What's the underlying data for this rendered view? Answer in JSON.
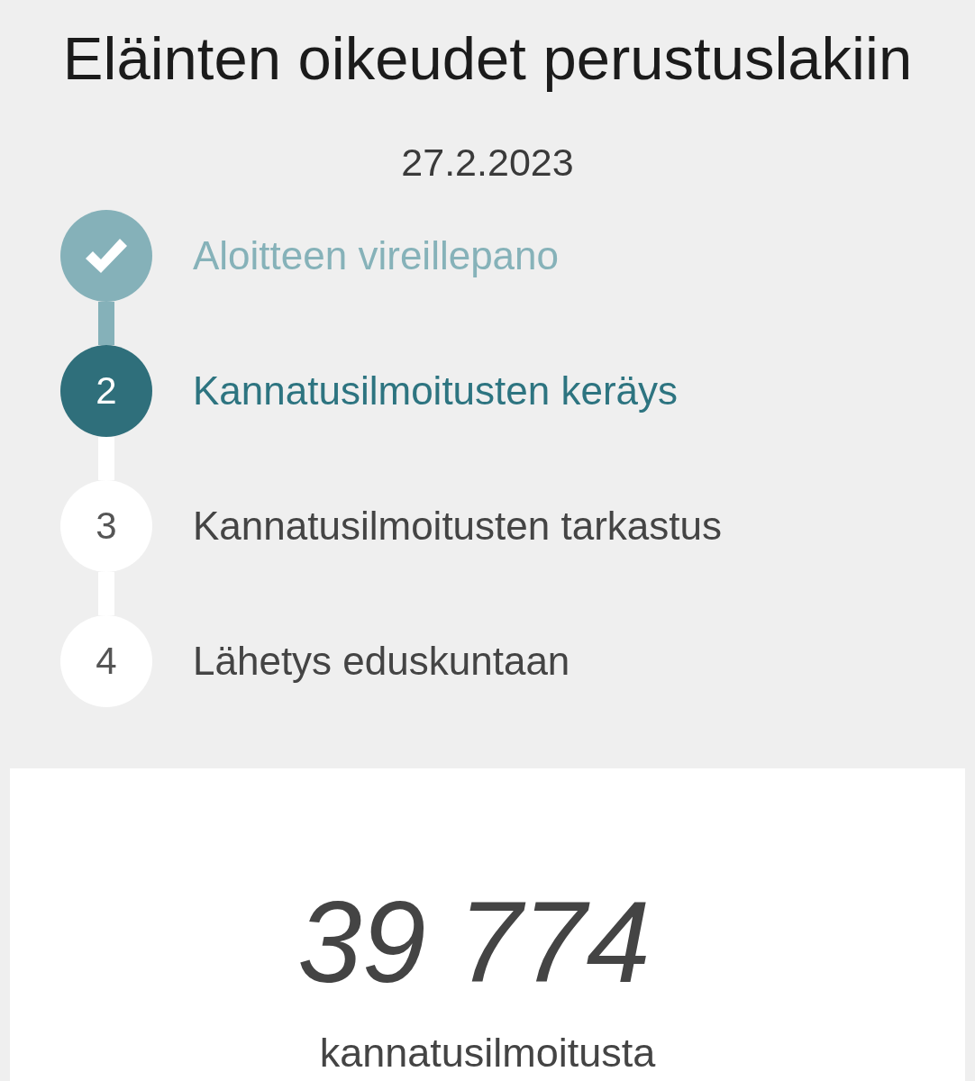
{
  "title": "Eläinten oikeudet perustuslakiin",
  "date": "27.2.2023",
  "steps": [
    {
      "label": "Aloitteen vireillepano",
      "done": true,
      "current": false
    },
    {
      "number": "2",
      "label": "Kannatusilmoitusten keräys",
      "done": false,
      "current": true
    },
    {
      "number": "3",
      "label": "Kannatusilmoitusten tarkastus",
      "done": false,
      "current": false
    },
    {
      "number": "4",
      "label": "Lähetys eduskuntaan",
      "done": false,
      "current": false
    }
  ],
  "count_card": {
    "count": "39 774",
    "unit": "kannatusilmoitusta"
  }
}
